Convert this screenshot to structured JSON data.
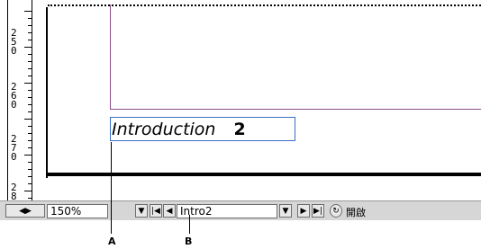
{
  "ruler": {
    "labels": [
      {
        "text": "2\n5\n0"
      },
      {
        "text": "2\n6\n0"
      },
      {
        "text": "2\n7\n0"
      },
      {
        "text": "2\n8"
      }
    ]
  },
  "document": {
    "heading_text": "Introduction",
    "page_number": "2"
  },
  "statusbar": {
    "zoom_value": "150%",
    "page_value": "Intro2",
    "status_text": "開啟",
    "icons": [
      "scroll-toggle-icon",
      "dropdown-arrow-icon",
      "first-page-icon",
      "prev-page-icon",
      "dropdown-arrow-icon",
      "next-page-icon",
      "last-page-icon",
      "open-file-icon"
    ]
  },
  "callouts": {
    "a": "A",
    "b": "B"
  }
}
